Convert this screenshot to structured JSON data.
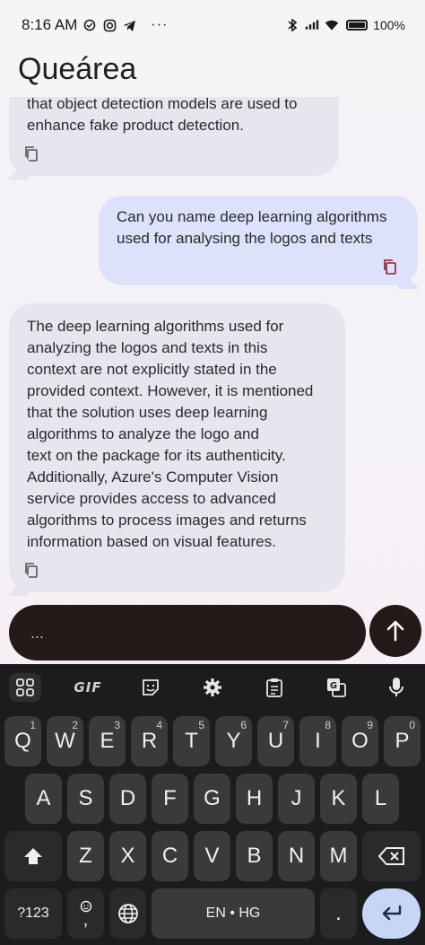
{
  "status_bar": {
    "time": "8:16 AM",
    "more": "···",
    "battery": "100%"
  },
  "app": {
    "title": "Queárea"
  },
  "chat": {
    "messages": [
      {
        "role": "bot",
        "text": "that object detection models are used to\nenhance fake product detection."
      },
      {
        "role": "user",
        "text": "Can you name deep learning algorithms\nused for analysing the logos and texts"
      },
      {
        "role": "bot",
        "text": "The deep learning algorithms used for\nanalyzing the logos and texts in this\ncontext are not explicitly stated in the\nprovided context. However, it is mentioned\nthat the solution uses deep learning\nalgorithms to analyze the logo and\ntext on the package for its authenticity.\nAdditionally, Azure's Computer Vision\nservice provides access to advanced\nalgorithms to process images and returns\ninformation based on visual features."
      }
    ]
  },
  "input": {
    "value": "..."
  },
  "keyboard": {
    "toolbar": {
      "gif": "GIF"
    },
    "row1": [
      {
        "k": "Q",
        "s": "1"
      },
      {
        "k": "W",
        "s": "2"
      },
      {
        "k": "E",
        "s": "3"
      },
      {
        "k": "R",
        "s": "4"
      },
      {
        "k": "T",
        "s": "5"
      },
      {
        "k": "Y",
        "s": "6"
      },
      {
        "k": "U",
        "s": "7"
      },
      {
        "k": "I",
        "s": "8"
      },
      {
        "k": "O",
        "s": "9"
      },
      {
        "k": "P",
        "s": "0"
      }
    ],
    "row2": [
      "A",
      "S",
      "D",
      "F",
      "G",
      "H",
      "J",
      "K",
      "L"
    ],
    "row3": [
      "Z",
      "X",
      "C",
      "V",
      "B",
      "N",
      "M"
    ],
    "symbols": "?123",
    "emoji_comma": ",",
    "space": "EN • HG",
    "period": "."
  },
  "colors": {
    "bot_bubble": "#e6e6ee",
    "user_bubble": "#dde2fa",
    "copy_icon_user": "#8a1c2c",
    "keyboard_bg": "#1c1c1e",
    "enter_key": "#c6d6f4"
  }
}
